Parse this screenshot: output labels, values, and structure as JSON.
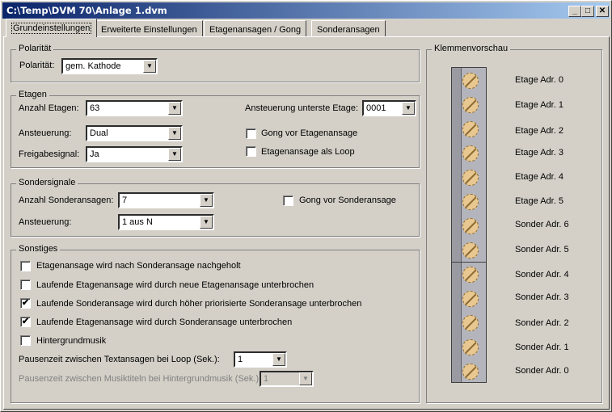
{
  "window": {
    "title": "C:\\Temp\\DVM 70\\Anlage 1.dvm",
    "minimize": "_",
    "maximize": "□",
    "close": "✕"
  },
  "tabs": [
    {
      "label": "Grundeinstellungen",
      "active": true
    },
    {
      "label": "Erweiterte Einstellungen",
      "active": false
    },
    {
      "label": "Etagenansagen / Gong",
      "active": false
    },
    {
      "label": "Sonderansagen",
      "active": false
    }
  ],
  "polaritaet": {
    "group": "Polarität",
    "label": "Polarität:",
    "value": "gem. Kathode"
  },
  "etagen": {
    "group": "Etagen",
    "anzahl_label": "Anzahl Etagen:",
    "anzahl_value": "63",
    "ansteuerung_label": "Ansteuerung:",
    "ansteuerung_value": "Dual",
    "freigabe_label": "Freigabesignal:",
    "freigabe_value": "Ja",
    "unterste_label": "Ansteuerung unterste Etage:",
    "unterste_value": "0001",
    "gong_label": "Gong vor Etagenansage",
    "gong_checked": false,
    "loop_label": "Etagenansage als Loop",
    "loop_checked": false
  },
  "sondersignale": {
    "group": "Sondersignale",
    "anzahl_label": "Anzahl Sonderansagen:",
    "anzahl_value": "7",
    "ansteuerung_label": "Ansteuerung:",
    "ansteuerung_value": "1 aus N",
    "gong_label": "Gong vor Sonderansage",
    "gong_checked": false
  },
  "sonstiges": {
    "group": "Sonstiges",
    "options": [
      {
        "label": "Etagenansage wird nach Sonderansage nachgeholt",
        "checked": false
      },
      {
        "label": "Laufende Etagenansage wird durch neue Etagenansage unterbrochen",
        "checked": false
      },
      {
        "label": "Laufende Sonderansage wird durch höher priorisierte Sonderansage unterbrochen",
        "checked": true
      },
      {
        "label": "Laufende Etagenansage wird durch Sonderansage unterbrochen",
        "checked": true
      },
      {
        "label": "Hintergrundmusik",
        "checked": false
      }
    ],
    "pause_text_label": "Pausenzeit zwischen Textansagen bei Loop (Sek.):",
    "pause_text_value": "1",
    "pause_musik_label": "Pausenzeit zwischen Musiktiteln bei Hintergrundmusik (Sek.):",
    "pause_musik_value": "1"
  },
  "klemmen": {
    "group": "Klemmenvorschau",
    "labels": [
      "Etage Adr. 0",
      "Etage Adr. 1",
      "Etage Adr. 2",
      "Etage Adr. 3",
      "Etage Adr. 4",
      "Etage Adr. 5",
      "Sonder Adr. 6",
      "Sonder Adr. 5",
      "Sonder Adr. 4",
      "Sonder Adr. 3",
      "Sonder Adr. 2",
      "Sonder Adr. 1",
      "Sonder Adr. 0"
    ]
  },
  "checkmark": "✔",
  "dropdown_arrow": "▼"
}
